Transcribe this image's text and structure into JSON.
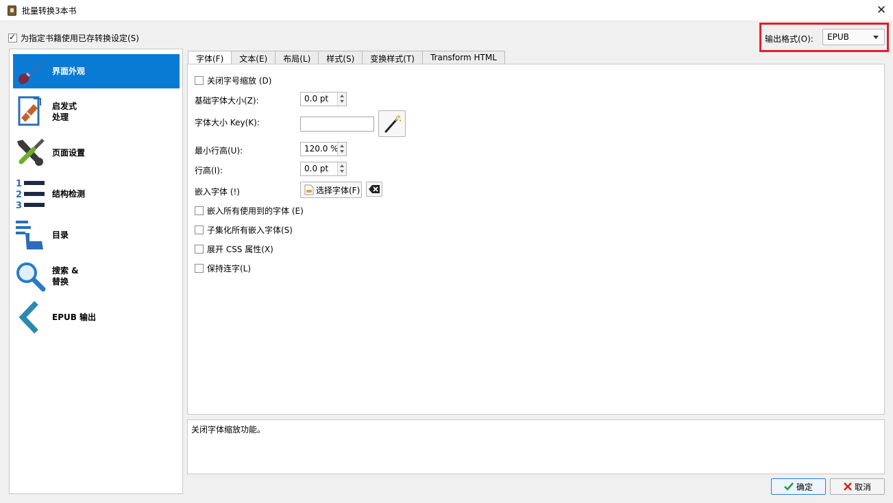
{
  "window": {
    "title": "批量转换3本书",
    "close_glyph": "✕"
  },
  "top": {
    "use_saved_label": "为指定书籍使用已存转换设定(S)",
    "use_saved_checked": true,
    "output_format_label": "输出格式(O):",
    "output_format_value": "EPUB"
  },
  "sidebar": {
    "items": [
      {
        "label": "界面外观",
        "icon": "brush-icon",
        "active": true
      },
      {
        "label": "启发式\n处理",
        "icon": "heuristics-document-icon",
        "active": false
      },
      {
        "label": "页面设置",
        "icon": "wrench-screwdriver-icon",
        "active": false
      },
      {
        "label": "结构检测",
        "icon": "numbered-list-icon",
        "active": false
      },
      {
        "label": "目录",
        "icon": "toc-hand-icon",
        "active": false
      },
      {
        "label": "搜索 &\n替换",
        "icon": "magnifier-icon",
        "active": false
      },
      {
        "label": "EPUB 输出",
        "icon": "chevron-left-icon",
        "active": false
      }
    ]
  },
  "tabs": [
    {
      "label": "字体(F)",
      "active": true
    },
    {
      "label": "文本(E)",
      "active": false
    },
    {
      "label": "布局(L)",
      "active": false
    },
    {
      "label": "样式(S)",
      "active": false
    },
    {
      "label": "变换样式(T)",
      "active": false
    },
    {
      "label": "Transform HTML",
      "active": false
    }
  ],
  "font_panel": {
    "disable_font_rescaling": {
      "label": "关闭字号缩放 (D)",
      "checked": false
    },
    "base_font_size": {
      "label": "基础字体大小(Z):",
      "value": "0.0 pt"
    },
    "font_size_key": {
      "label": "字体大小 Key(K):",
      "value": ""
    },
    "min_line_height": {
      "label": "最小行高(U):",
      "value": "120.0 %"
    },
    "line_height": {
      "label": "行高(I):",
      "value": "0.0 pt"
    },
    "embed_font": {
      "label": "嵌入字体 (!)",
      "button_label": "选择字体(F)"
    },
    "embed_all_fonts": {
      "label": "嵌入所有使用到的字体 (E)",
      "checked": false
    },
    "subset_fonts": {
      "label": "子集化所有嵌入字体(S)",
      "checked": false
    },
    "expand_css": {
      "label": "展开 CSS 属性(X)",
      "checked": false
    },
    "keep_ligatures": {
      "label": "保持连字(L)",
      "checked": false
    }
  },
  "description": "关闭字体缩放功能。",
  "buttons": {
    "ok_label": "确定",
    "cancel_label": "取消"
  },
  "colors": {
    "accent": "#0a7bd4",
    "highlight_frame": "#e0202a",
    "ok_check": "#1f9a3a",
    "cancel_x": "#d42020"
  }
}
